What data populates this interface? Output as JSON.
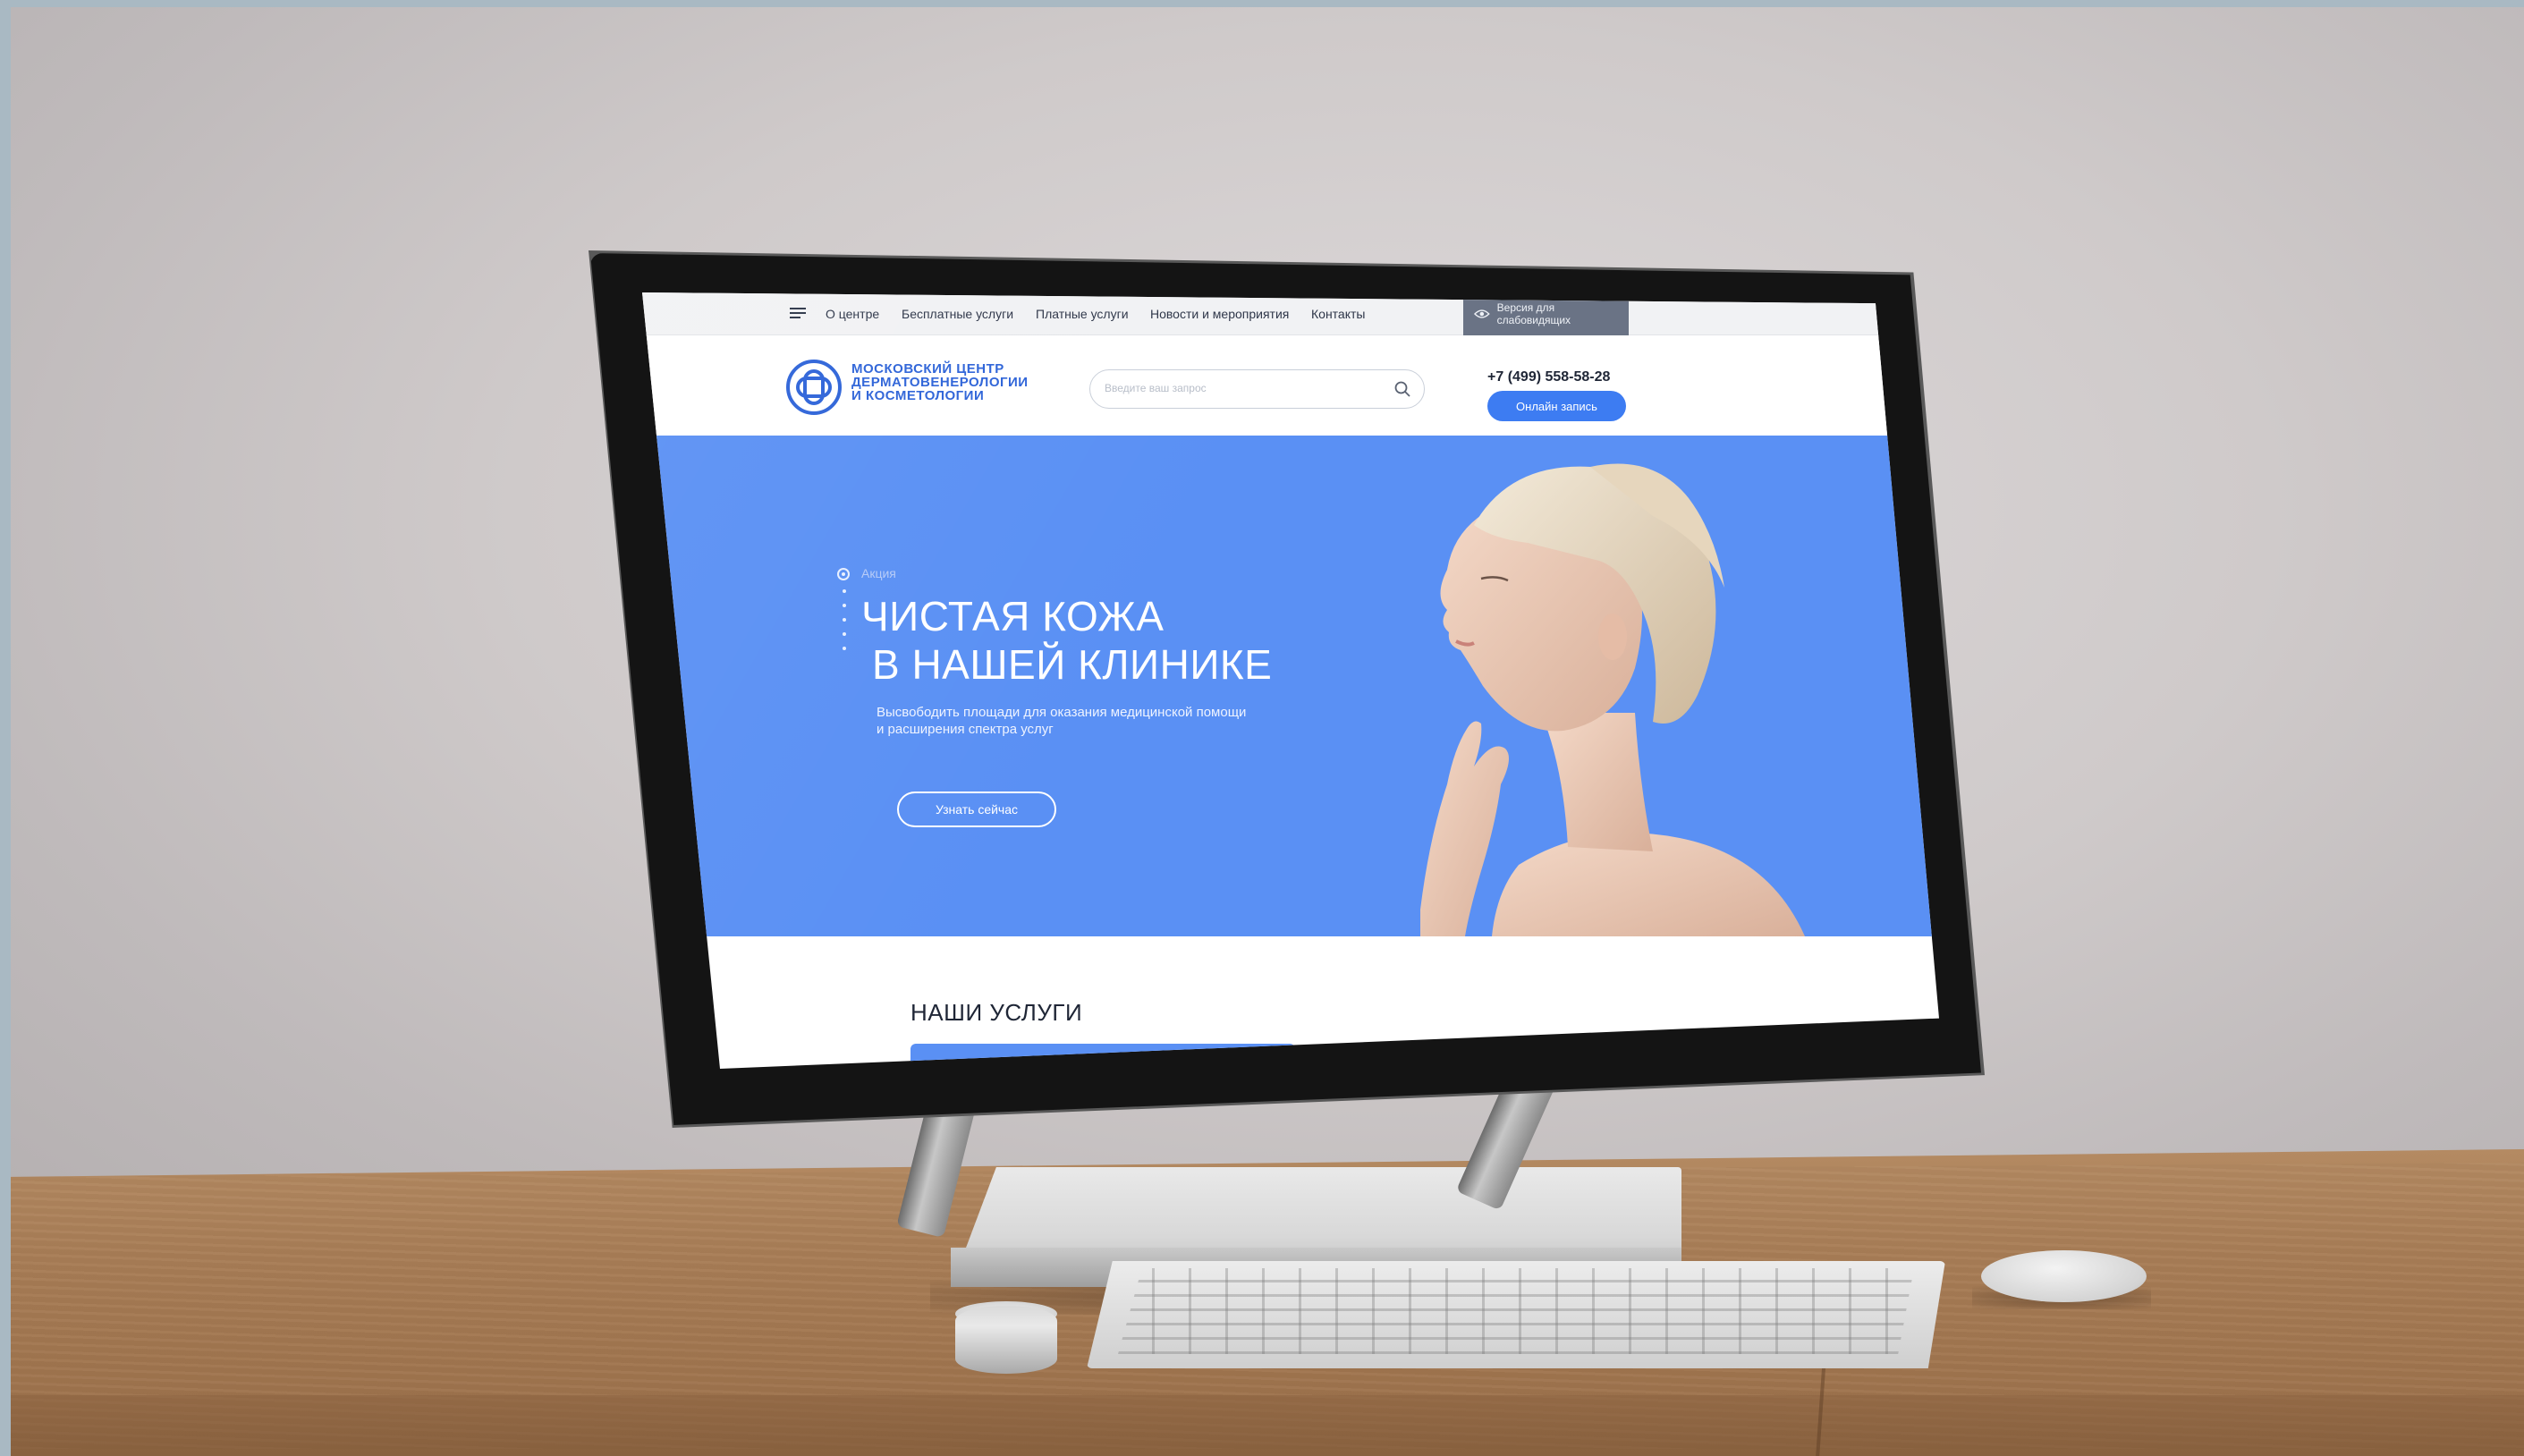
{
  "topbar": {
    "nav": [
      {
        "label": "О центре"
      },
      {
        "label": "Бесплатные услуги"
      },
      {
        "label": "Платные услуги"
      },
      {
        "label": "Новости и мероприятия"
      },
      {
        "label": "Контакты"
      }
    ],
    "low_vision_label": "Версия для слабовидящих"
  },
  "header": {
    "logo_lines": [
      "МОСКОВСКИЙ ЦЕНТР",
      "ДЕРМАТОВЕНЕРОЛОГИИ",
      "И КОСМЕТОЛОГИИ"
    ],
    "search_placeholder": "Введите ваш запрос",
    "phone": "+7 (499) 558-58-28",
    "book_button": "Онлайн запись"
  },
  "hero": {
    "promo_label": "Акция",
    "title_lines": [
      "ЧИСТАЯ КОЖА",
      "В НАШЕЙ КЛИНИКЕ"
    ],
    "subtitle": "Высвободить площади для оказания медицинской помощи и расширения спектра услуг",
    "cta": "Узнать сейчас"
  },
  "services": {
    "title": "НАШИ УСЛУГИ"
  },
  "colors": {
    "brand_blue": "#3d7cf2",
    "hero_blue": "#5a90f4",
    "logo_blue": "#2d63d8",
    "low_vision_bg": "#6a7385"
  },
  "icons": [
    "menu-icon",
    "eye-icon",
    "search-icon",
    "logo-mark"
  ]
}
